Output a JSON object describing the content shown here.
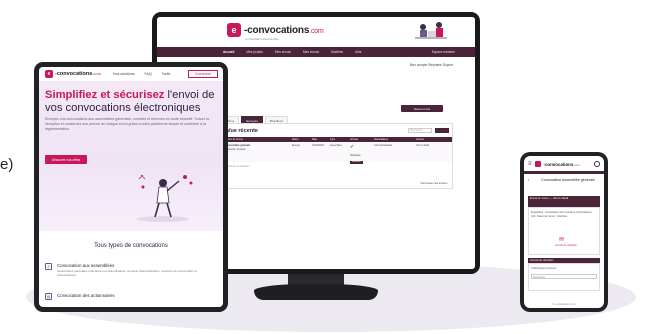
{
  "edge_text": "e)",
  "brand": {
    "logo_letter": "e",
    "name": "-convocations",
    "domain": ".com",
    "tagline": "Convocation électronique",
    "accent_color": "#c8185a",
    "dark_color": "#4a2438"
  },
  "desktop": {
    "nav": [
      "Accueil",
      "Mes projets",
      "Mes envois",
      "Mes envois",
      "Modèles",
      "Aide"
    ],
    "nav_right": "Espace membre",
    "user": "Mon compte Stéphane Dupont",
    "action_button": "Nouvel envoi",
    "tabs": [
      "Tous",
      "Envoyés",
      "Brouillons"
    ],
    "card_title": "Vue récente",
    "search_placeholder": "Rechercher",
    "columns": [
      "Nom de l'envoi",
      "Statut",
      "Date",
      "Type",
      "Accusé",
      "Destinataires",
      "Actions"
    ],
    "row": {
      "name": "Assemblée générale",
      "detail": "Réunion annuelle",
      "status": "Envoyé",
      "date": "12/03/2024",
      "type": "Assemblée",
      "check": "✔",
      "check_label": "Distribuée",
      "recipients": "124 destinataires",
      "action": "Voir le détail",
      "pill": "Relancer"
    },
    "subrow": "Archiver la sélection",
    "pager": "Voir toutes mes envois ›"
  },
  "tablet": {
    "nav": [
      "Nos solutions",
      "FAQ",
      "Tarifs"
    ],
    "connect": "Connexion",
    "hero_pink": "Simplifiez et sécurisez",
    "hero_rest": "l'envoi de vos convocations électroniques",
    "lead": "Envoyez vos convocations aux assemblées générales, conseils et réunions en toute sécurité. Suivez la réception et conservez une preuve de chaque envoi grâce à notre plateforme simple et conforme à la réglementation.",
    "cta": "Découvrir nos offres",
    "section_title": "Tous types de convocations",
    "items": [
      {
        "title": "Convocation aux assemblées",
        "text": "Assemblées générales ordinaires et extraordinaires, conseils d'administration, réunions de copropriété ou d'associations."
      },
      {
        "title": "Convocation des actionnaires",
        "text": ""
      }
    ]
  },
  "phone": {
    "title": "Convocation Assemblée générale",
    "card_head": "Envoi en cours — Voir le détail",
    "card_text": "Expéditeur : Association des membres. Destinataires : 124. Statut de l'envoi : distribué.",
    "badge_text": "Accusé de réception",
    "card2_head": "Accusé de réception",
    "card2_text": "Télécharger la preuve",
    "field": "Rechercher",
    "footer": "© e-convocations.com"
  }
}
